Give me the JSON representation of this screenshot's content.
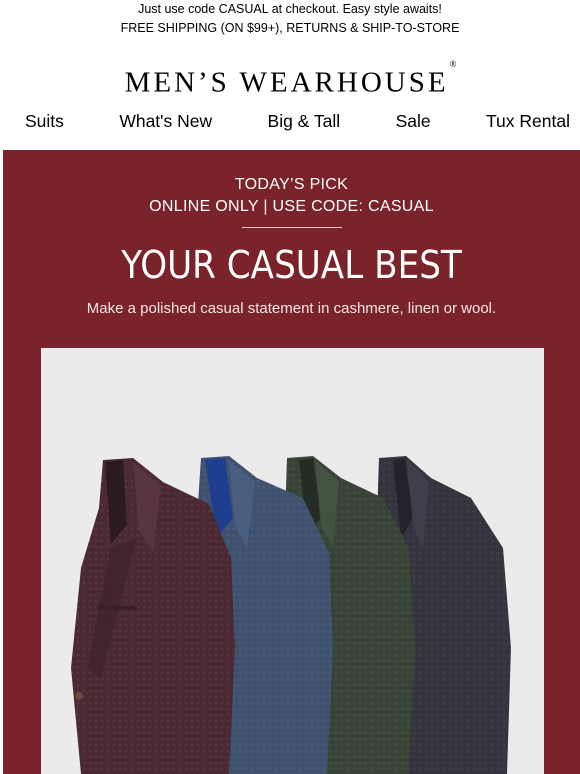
{
  "preheader": {
    "line1": "Just use code CASUAL at checkout. Easy style awaits!",
    "line2": "FREE SHIPPING (ON $99+), RETURNS & SHIP-TO-STORE"
  },
  "brand": {
    "name": "MEN’S WEARHOUSE",
    "trademark": "®"
  },
  "nav": {
    "suits": "Suits",
    "whats_new": "What's New",
    "big_tall": "Big & Tall",
    "sale": "Sale",
    "tux_rental": "Tux Rental"
  },
  "hero": {
    "kicker1": "TODAY’S PICK",
    "kicker2": "ONLINE ONLY | USE CODE: CASUAL",
    "headline": "YOUR CASUAL BEST",
    "subline": "Make a polished casual statement in cashmere, linen or wool.",
    "background_color": "#7a232b"
  },
  "product_image": {
    "jackets": [
      "burgundy-jacket",
      "blue-jacket",
      "green-jacket",
      "charcoal-jacket"
    ]
  }
}
